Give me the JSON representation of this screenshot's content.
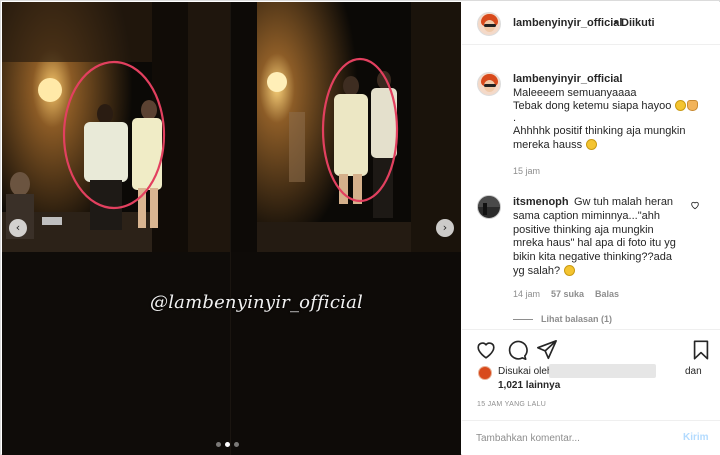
{
  "media": {
    "watermark": "@lambenyinyir_official",
    "carousel": {
      "slides": 3,
      "active_slide": 2
    }
  },
  "header": {
    "username": "lambenyinyir_official",
    "separator": "•",
    "follow_status": "Diikuti"
  },
  "caption": {
    "username": "lambenyinyir_official",
    "dot": ".",
    "lines": [
      "Maleeeem semuanyaaaa",
      "Tebak dong ketemu siapa hayoo",
      ".",
      "Ahhhhk positif thinking aja mungkin",
      "mereka hauss"
    ],
    "time": "15 jam"
  },
  "comment": {
    "username": "itsmenoph",
    "lines": [
      "Gw tuh malah heran",
      "sama caption miminnya...\"ahh",
      "positive thinking aja mungkin",
      "mreka haus\" hal apa di foto itu yg",
      "bikin kita negative thinking??ada",
      "yg salah?"
    ],
    "time": "14 jam",
    "likes": "57 suka",
    "reply": "Balas",
    "view_replies": "Lihat balasan (1)"
  },
  "likes": {
    "prefix": "Disukai oleh",
    "and": "dan",
    "count": "1,021 lainnya"
  },
  "post_date": "15 JAM YANG LALU",
  "add_comment": {
    "placeholder": "Tambahkan komentar...",
    "post_label": "Kirim"
  },
  "colors": {
    "circle_highlight": "#e2405f",
    "link_disabled": "#b3dbff",
    "muted_text": "#8e8e8e"
  }
}
